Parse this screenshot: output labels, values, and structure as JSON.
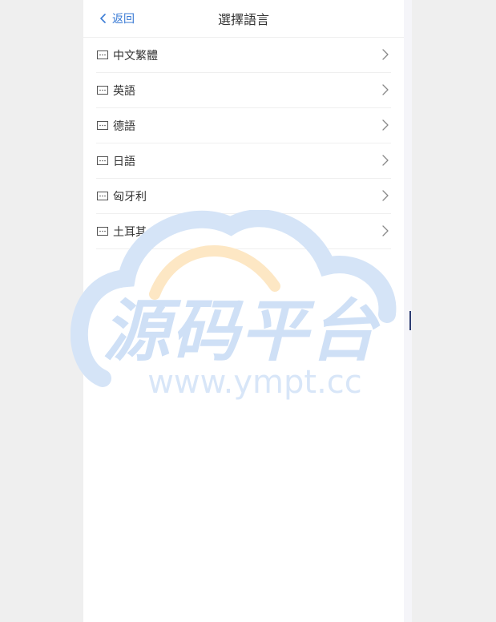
{
  "header": {
    "back_label": "返回",
    "title": "選擇語言"
  },
  "languages": [
    {
      "label": "中文繁體"
    },
    {
      "label": "英語"
    },
    {
      "label": "德語"
    },
    {
      "label": "日語"
    },
    {
      "label": "匈牙利"
    },
    {
      "label": "土耳其"
    }
  ],
  "watermark": {
    "text": "源码平台",
    "url": "www.ympt.cc"
  },
  "colors": {
    "accent": "#3a7bd5",
    "watermark_blue": "#c9dcf5",
    "watermark_orange": "#fde2b8"
  },
  "icons": {
    "back": "chevron-left-icon",
    "item": "message-dots-icon",
    "arrow": "chevron-right-icon"
  }
}
